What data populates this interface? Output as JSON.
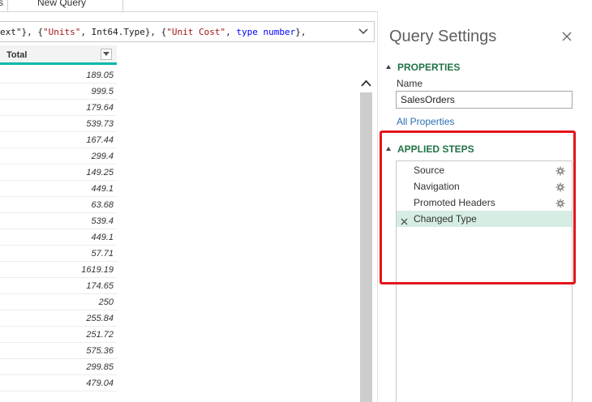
{
  "tabs": {
    "partial_label": "s",
    "new_query_label": "New Query"
  },
  "formula_bar": {
    "segments": [
      {
        "text": "ext\"}, {",
        "kind": "plain"
      },
      {
        "text": "\"Units\"",
        "kind": "string"
      },
      {
        "text": ", Int64.Type}, {",
        "kind": "plain"
      },
      {
        "text": "\"Unit Cost\"",
        "kind": "string"
      },
      {
        "text": ", ",
        "kind": "plain"
      },
      {
        "text": "type",
        "kind": "keyword"
      },
      {
        "text": " ",
        "kind": "plain"
      },
      {
        "text": "number",
        "kind": "keyword"
      },
      {
        "text": "},",
        "kind": "plain"
      }
    ]
  },
  "grid": {
    "column_header": "Total",
    "values": [
      "189.05",
      "999.5",
      "179.64",
      "539.73",
      "167.44",
      "299.4",
      "149.25",
      "449.1",
      "63.68",
      "539.4",
      "449.1",
      "57.71",
      "1619.19",
      "174.65",
      "250",
      "255.84",
      "251.72",
      "575.36",
      "299.85",
      "479.04"
    ]
  },
  "query_settings": {
    "title": "Query Settings",
    "properties_heading": "PROPERTIES",
    "name_label": "Name",
    "name_value": "SalesOrders",
    "all_properties_link": "All Properties",
    "applied_steps_heading": "APPLIED STEPS",
    "steps": [
      {
        "label": "Source",
        "has_gear": true,
        "selected": false
      },
      {
        "label": "Navigation",
        "has_gear": true,
        "selected": false
      },
      {
        "label": "Promoted Headers",
        "has_gear": true,
        "selected": false
      },
      {
        "label": "Changed Type",
        "has_gear": false,
        "selected": true
      }
    ]
  },
  "colors": {
    "accent_green": "#217346",
    "column_underline": "#01b8aa",
    "selected_step": "#d5ede2",
    "highlight_red": "#e3151a",
    "link_blue": "#2b6eb3"
  },
  "icons": {
    "formula_expand": "chevron-down-icon",
    "column_filter": "dropdown-arrow-icon",
    "scroll_up": "chevron-up-icon",
    "pane_close": "close-icon",
    "step_settings": "gear-icon",
    "step_delete": "delete-x-icon"
  }
}
